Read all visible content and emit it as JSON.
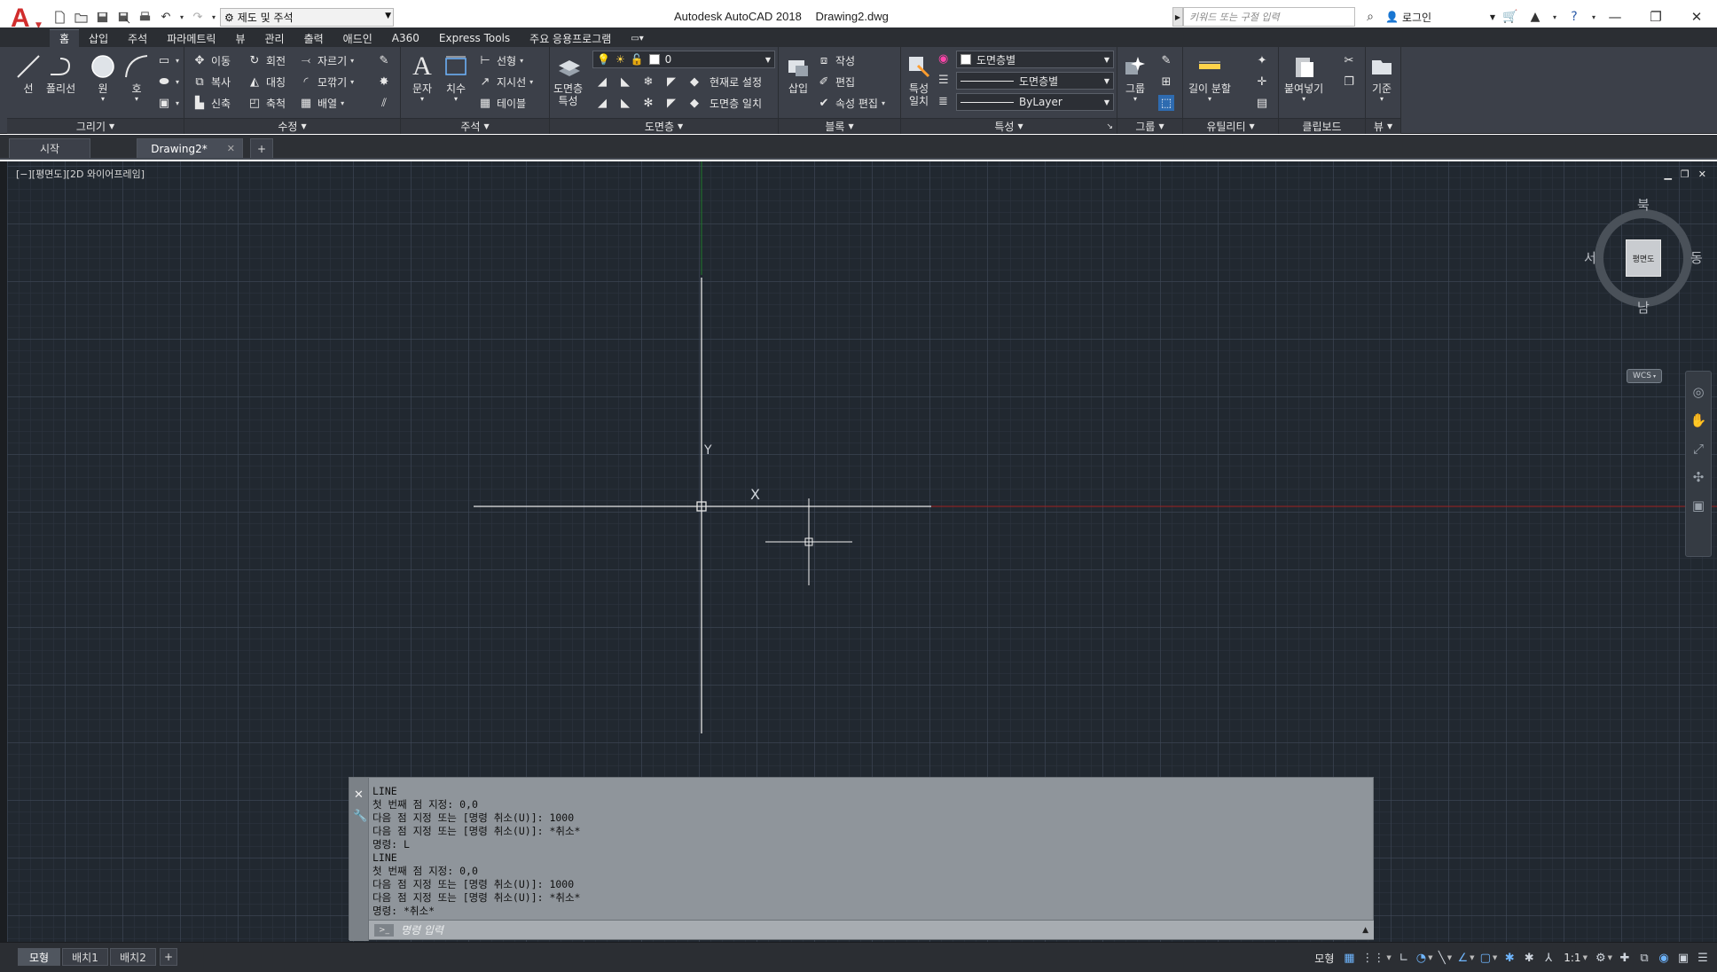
{
  "title_bar": {
    "app_name": "Autodesk AutoCAD 2018",
    "file_name": "Drawing2.dwg",
    "workspace": "제도 및 주석",
    "search_placeholder": "키워드 또는 구절 입력",
    "login_label": "로그인"
  },
  "ribbon_tabs": [
    {
      "label": "홈",
      "active": true
    },
    {
      "label": "삽입"
    },
    {
      "label": "주석"
    },
    {
      "label": "파라메트릭"
    },
    {
      "label": "뷰"
    },
    {
      "label": "관리"
    },
    {
      "label": "출력"
    },
    {
      "label": "애드인"
    },
    {
      "label": "A360"
    },
    {
      "label": "Express Tools"
    },
    {
      "label": "주요 응용프로그램"
    }
  ],
  "ribbon": {
    "draw": {
      "title": "그리기",
      "line": "선",
      "polyline": "폴리선",
      "circle": "원",
      "arc": "호"
    },
    "modify": {
      "title": "수정",
      "move": "이동",
      "rotate": "회전",
      "trim": "자르기",
      "copy": "복사",
      "mirror": "대칭",
      "fillet": "모깎기",
      "stretch": "신축",
      "scale": "축척",
      "array": "배열"
    },
    "annotation": {
      "title": "주석",
      "text": "문자",
      "dimension": "치수",
      "linear": "선형",
      "leader": "지시선",
      "table": "테이블"
    },
    "layers": {
      "title": "도면층",
      "layer_properties": "도면층\n특성",
      "layer_value": "0",
      "set_current": "현재로 설정",
      "match_layer": "도면층 일치"
    },
    "block": {
      "title": "블록",
      "insert": "삽입",
      "create": "작성",
      "edit": "편집",
      "edit_attributes": "속성 편집"
    },
    "properties": {
      "title": "특성",
      "match_properties": "특성\n일치",
      "color_value": "도면층별",
      "linetype_value": "도면층별",
      "lineweight_value": "ByLayer"
    },
    "groups": {
      "title": "그룹",
      "group": "그룹"
    },
    "utilities": {
      "title": "유틸리티",
      "measure": "길이 분할"
    },
    "clipboard": {
      "title": "클립보드",
      "paste": "붙여넣기"
    },
    "view": {
      "title": "뷰",
      "base": "기준"
    }
  },
  "doc_tabs": [
    {
      "label": "시작"
    },
    {
      "label": "Drawing2*",
      "active": true
    }
  ],
  "viewport": {
    "label": "[−][평면도][2D 와이어프레임]",
    "ucs_y": "Y",
    "ucs_x": "X"
  },
  "viewcube": {
    "north": "북",
    "south": "남",
    "east": "동",
    "west": "서",
    "face": "평면도",
    "wcs": "WCS"
  },
  "command_window": {
    "history": [
      "LINE",
      "첫 번째 점 지정: 0,0",
      "다음 점 지정 또는 [명령 취소(U)]: 1000",
      "다음 점 지정 또는 [명령 취소(U)]: *취소*",
      "명령: L",
      "LINE",
      "첫 번째 점 지정: 0,0",
      "다음 점 지정 또는 [명령 취소(U)]: 1000",
      "다음 점 지정 또는 [명령 취소(U)]: *취소*",
      "명령: *취소*"
    ],
    "input_placeholder": "명령 입력"
  },
  "status_bar": {
    "layout_tabs": [
      {
        "label": "모형",
        "active": true
      },
      {
        "label": "배치1"
      },
      {
        "label": "배치2"
      }
    ],
    "model_label": "모형",
    "scale": "1:1"
  },
  "colors": {
    "canvas_bg": "#212830",
    "ribbon_bg": "#3c4049",
    "accent_blue": "#6fb6ff",
    "x_axis_red": "#a02020",
    "y_axis_green": "#1e7a2a"
  }
}
